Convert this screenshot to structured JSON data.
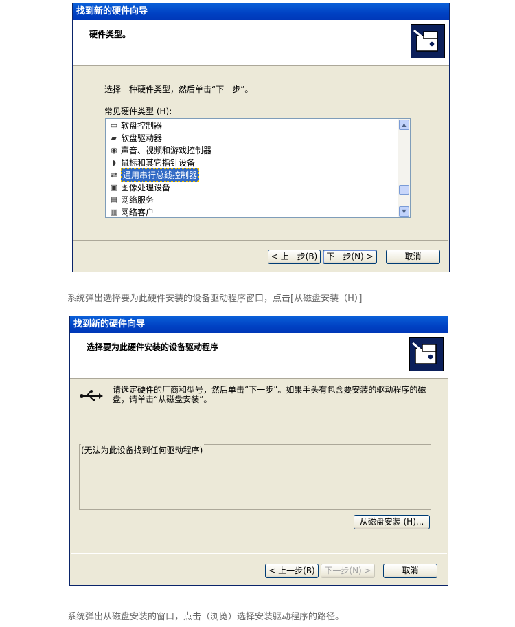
{
  "window1": {
    "title": "找到新的硬件向导",
    "header_title": "硬件类型。",
    "instruction": "选择一种硬件类型，然后单击“下一步”。",
    "list_label": "常见硬件类型 (H):",
    "list_items": [
      {
        "label": "软盘控制器",
        "icon": "floppy-controller-icon"
      },
      {
        "label": "软盘驱动器",
        "icon": "floppy-drive-icon"
      },
      {
        "label": "声音、视频和游戏控制器",
        "icon": "sound-icon"
      },
      {
        "label": "鼠标和其它指针设备",
        "icon": "mouse-icon"
      },
      {
        "label": "通用串行总线控制器",
        "icon": "usb-icon",
        "selected": true
      },
      {
        "label": "图像处理设备",
        "icon": "imaging-icon"
      },
      {
        "label": "网络服务",
        "icon": "network-service-icon"
      },
      {
        "label": "网络客户",
        "icon": "network-client-icon"
      }
    ],
    "back_label": "< 上一步(B)",
    "next_label": "下一步(N) >",
    "cancel_label": "取消"
  },
  "caption1": "系统弹出选择要为此硬件安装的设备驱动程序窗口，点击[从磁盘安装（H）]",
  "window2": {
    "title": "找到新的硬件向导",
    "header_title": "选择要为此硬件安装的设备驱动程序",
    "instruction": "请选定硬件的厂商和型号，然后单击“下一步”。如果手头有包含要安装的驱动程序的磁盘，请单击“从磁盘安装”。",
    "group_label": "(无法为此设备找到任何驱动程序)",
    "have_disk_label": "从磁盘安装 (H)...",
    "back_label": "< 上一步(B)",
    "next_label": "下一步(N) >",
    "cancel_label": "取消"
  },
  "caption2": "系统弹出从磁盘安装的窗口，点击（浏览）选择安装驱动程序的路径。"
}
